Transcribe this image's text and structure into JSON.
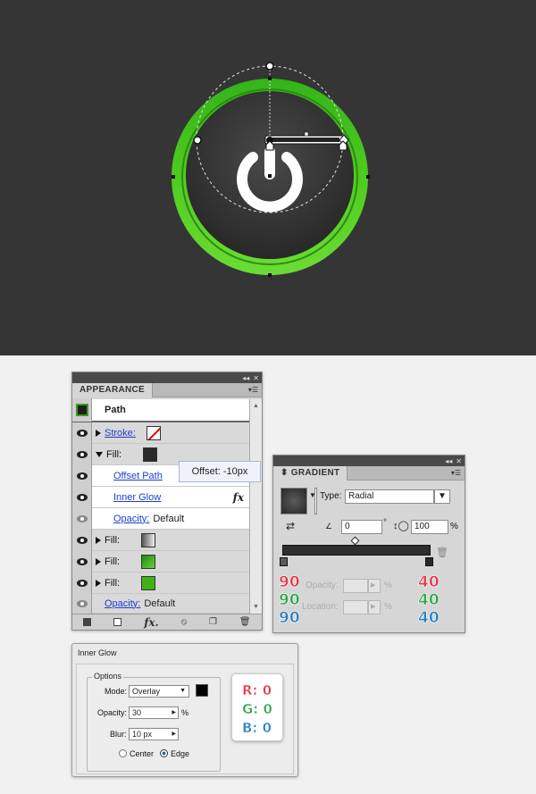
{
  "appearance": {
    "tab": "APPEARANCE",
    "object_label": "Path",
    "rows": [
      {
        "label": "Stroke:",
        "kind": "stroke"
      },
      {
        "label": "Fill:",
        "kind": "fill-dark"
      },
      {
        "label": "Offset Path",
        "kind": "effect"
      },
      {
        "label": "Inner Glow",
        "kind": "effect"
      },
      {
        "label": "Opacity:",
        "value": "Default",
        "kind": "effect-opacity"
      },
      {
        "label": "Fill:",
        "kind": "fill-radial"
      },
      {
        "label": "Fill:",
        "kind": "fill-green-gradient"
      },
      {
        "label": "Fill:",
        "kind": "fill-green"
      },
      {
        "label": "Opacity:",
        "value": "Default",
        "kind": "opacity"
      }
    ],
    "tooltip": "Offset: -10px",
    "fx_label": "fx"
  },
  "gradient": {
    "tab": "GRADIENT",
    "type_label": "Type:",
    "type_value": "Radial",
    "angle_value": "0",
    "degree_symbol": "°",
    "aspect_value": "100",
    "percent": "%",
    "opacity_label": "Opacity:",
    "location_label": "Location:",
    "left_stop": {
      "r": "90",
      "g": "90",
      "b": "90"
    },
    "right_stop": {
      "r": "40",
      "g": "40",
      "b": "40"
    }
  },
  "inner_glow": {
    "title": "Inner Glow",
    "options_label": "Options",
    "mode_label": "Mode:",
    "mode_value": "Overlay",
    "opacity_label": "Opacity:",
    "opacity_value": "30",
    "percent": "%",
    "blur_label": "Blur:",
    "blur_value": "10 px",
    "center_label": "Center",
    "edge_label": "Edge",
    "color_rgb": {
      "r": "R: 0",
      "g": "G: 0",
      "b": "B: 0"
    }
  },
  "colors": {
    "canvas_bg": "#353535",
    "ring_green": "#4cc21d",
    "red_label": "#e23a46",
    "green_label": "#2fa64a",
    "blue_label": "#2a7fc3"
  }
}
